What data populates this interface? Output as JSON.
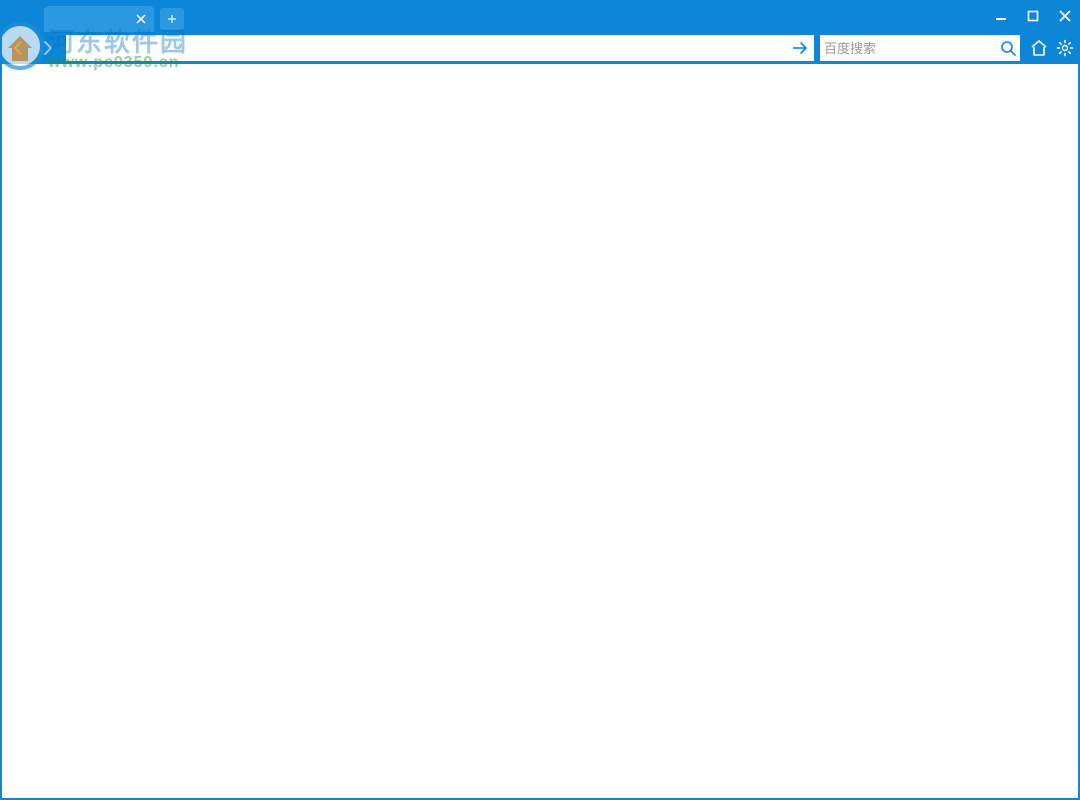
{
  "watermark": {
    "title": "河东软件园",
    "url": "www.pc0359.cn"
  },
  "tabs": {
    "active_title": "",
    "close_hint": "×",
    "new_tab_hint": "+"
  },
  "window_controls": {
    "minimize": "—",
    "maximize": "□",
    "close": "×"
  },
  "address": {
    "value": "",
    "placeholder": ""
  },
  "search": {
    "placeholder": "百度搜索"
  },
  "colors": {
    "brand": "#0d86d8",
    "tab_bg": "#2a99e2"
  }
}
